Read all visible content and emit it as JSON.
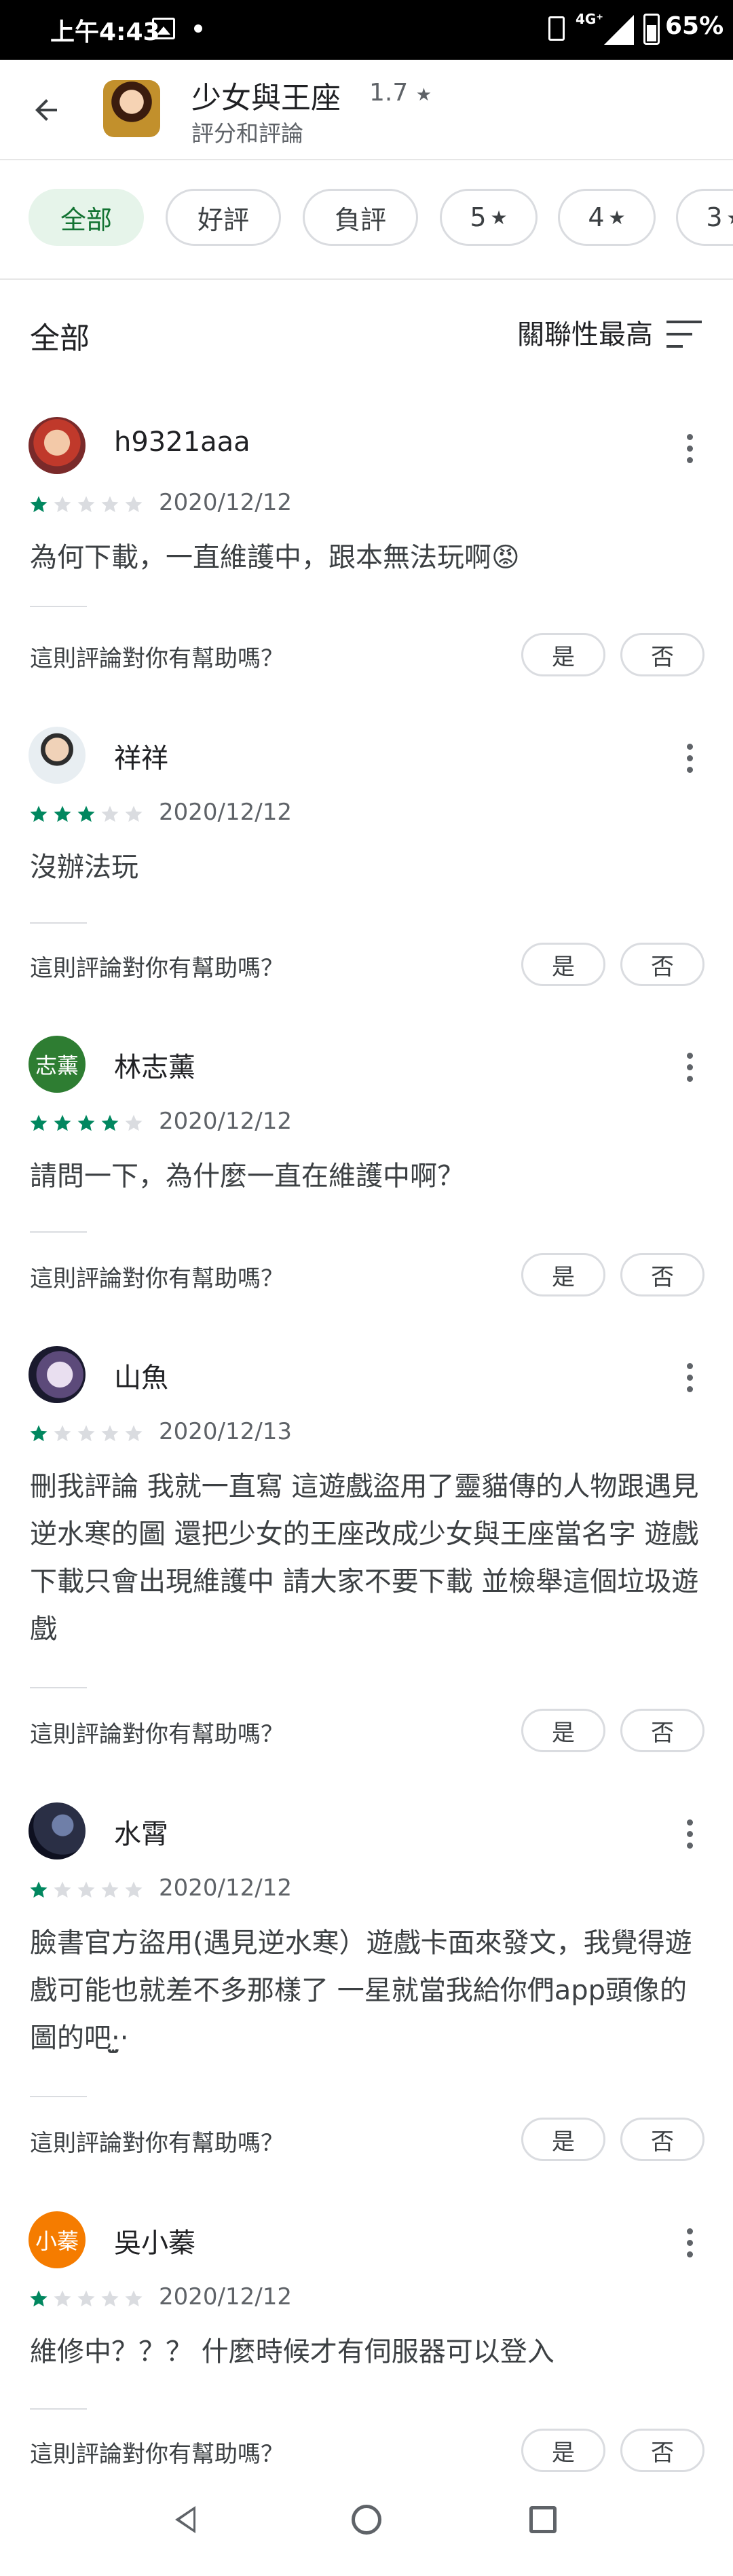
{
  "status_bar": {
    "time": "上午4:43",
    "network": "4G⁺",
    "battery": "65%"
  },
  "header": {
    "title": "少女與王座",
    "rating": "1.7",
    "subtitle": "評分和評論"
  },
  "filters": [
    {
      "label": "全部",
      "active": true
    },
    {
      "label": "好評",
      "active": false
    },
    {
      "label": "負評",
      "active": false
    },
    {
      "label": "5",
      "star": true,
      "active": false
    },
    {
      "label": "4",
      "star": true,
      "active": false
    },
    {
      "label": "3",
      "star": true,
      "active": false
    }
  ],
  "sort": {
    "title": "全部",
    "label": "關聯性最高"
  },
  "reviews": [
    {
      "author": "h9321aaa",
      "stars": 1,
      "date": "2020/12/12",
      "text": "為何下載，一直維護中，跟本無法玩啊😡",
      "helpful_q": "這則評論對你有幫助嗎？",
      "yes": "是",
      "no": "否",
      "avatar_initials": ""
    },
    {
      "author": "祥祥",
      "stars": 3,
      "date": "2020/12/12",
      "text": "沒辦法玩",
      "helpful_q": "這則評論對你有幫助嗎？",
      "yes": "是",
      "no": "否",
      "avatar_initials": ""
    },
    {
      "author": "林志薰",
      "stars": 4,
      "date": "2020/12/12",
      "text": "請問一下，為什麼一直在維護中啊？",
      "helpful_q": "這則評論對你有幫助嗎？",
      "yes": "是",
      "no": "否",
      "avatar_initials": "志薰"
    },
    {
      "author": "山魚",
      "stars": 1,
      "date": "2020/12/13",
      "text": "刪我評論 我就一直寫 這遊戲盜用了靈貓傳的人物跟遇見逆水寒的圖 還把少女的王座改成少女與王座當名字 遊戲下載只會出現維護中 請大家不要下載 並檢舉這個垃圾遊戲",
      "helpful_q": "這則評論對你有幫助嗎？",
      "yes": "是",
      "no": "否",
      "avatar_initials": ""
    },
    {
      "author": "水霄",
      "stars": 1,
      "date": "2020/12/12",
      "text": "臉書官方盜用(遇見逆水寒）遊戲卡面來發文，我覺得遊戲可能也就差不多那樣了 一星就當我給你們app頭像的圖的吧·̫̮·",
      "helpful_q": "這則評論對你有幫助嗎？",
      "yes": "是",
      "no": "否",
      "avatar_initials": ""
    },
    {
      "author": "吳小蓁",
      "stars": 1,
      "date": "2020/12/12",
      "text": "維修中？？？ 什麼時候才有伺服器可以登入",
      "helpful_q": "這則評論對你有幫助嗎？",
      "yes": "是",
      "no": "否",
      "avatar_initials": "小蓁"
    }
  ],
  "colors": {
    "star_filled": "#01875f",
    "star_empty": "#dadce0",
    "chip_active_bg": "#e6f4ea",
    "chip_active_text": "#137333"
  }
}
